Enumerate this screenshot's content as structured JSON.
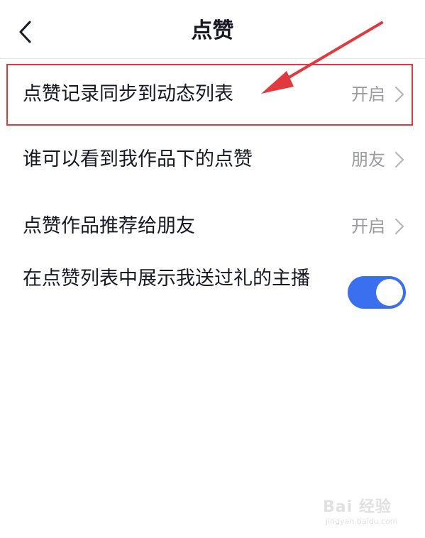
{
  "header": {
    "title": "点赞",
    "back_icon": "chevron-left-icon"
  },
  "settings": [
    {
      "label": "点赞记录同步到动态列表",
      "value": "开启"
    },
    {
      "label": "谁可以看到我作品下的点赞",
      "value": "朋友"
    },
    {
      "label": "点赞作品推荐给朋友",
      "value": "开启"
    },
    {
      "label": "在点赞列表中展示我送过礼的主播",
      "toggle_on": true
    }
  ],
  "annotation": {
    "highlight_color": "#e0393e"
  },
  "colors": {
    "accent": "#3a6ff0",
    "text": "#161823",
    "secondary_text": "#9a9ba0"
  },
  "watermark": {
    "logo": "Bai 经验",
    "url": "jingyan.baidu.com"
  }
}
